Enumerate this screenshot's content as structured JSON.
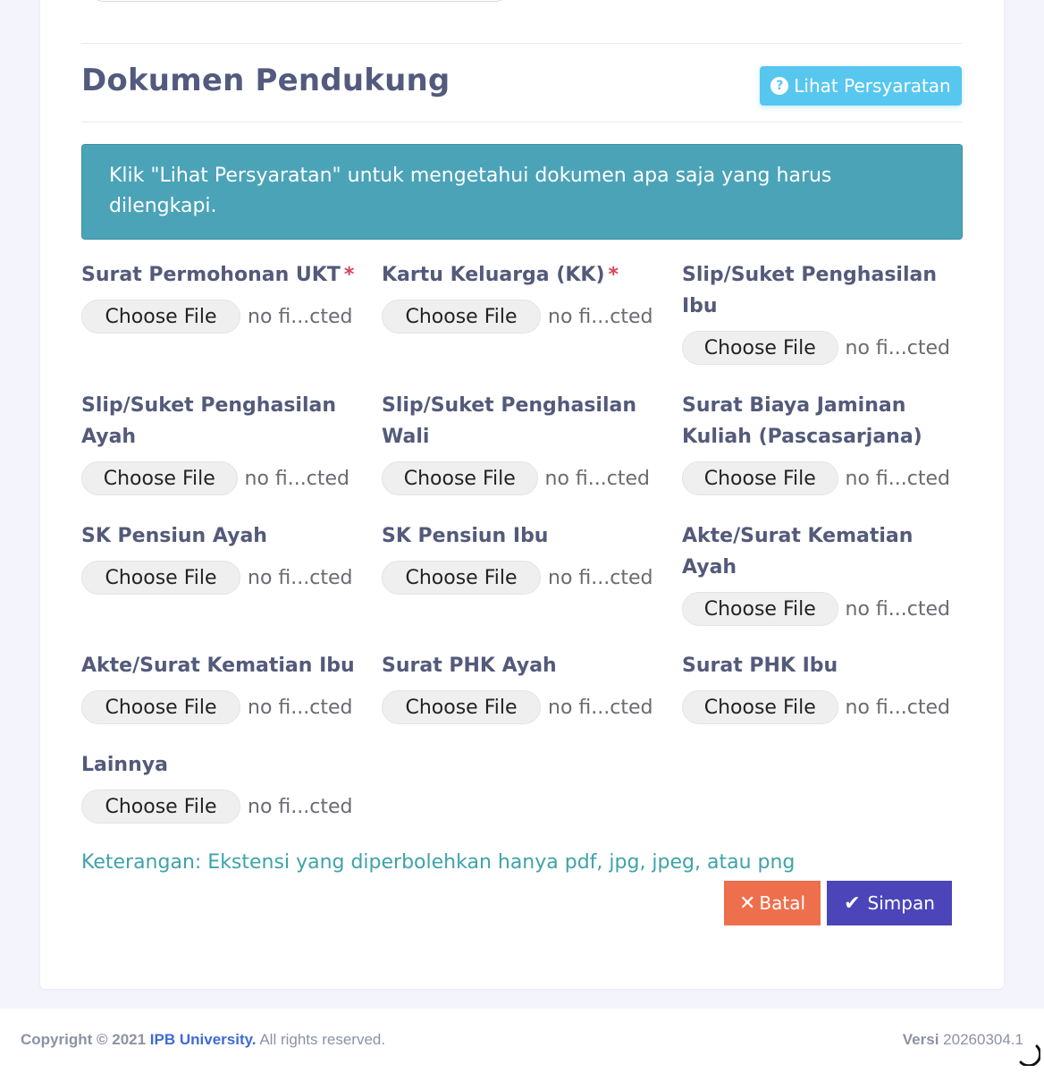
{
  "section": {
    "title": "Dokumen Pendukung",
    "requirements_button": "Lihat Persyaratan",
    "requirements_icon": "question-circle-icon"
  },
  "alert": {
    "text": "Klik \"Lihat Persyaratan\" untuk mengetahui dokumen apa saja yang harus dilengkapi."
  },
  "upload_fields": [
    {
      "label": "Surat Permohonan UKT",
      "required": "*",
      "button": "Choose File",
      "status": "no fi...cted"
    },
    {
      "label": "Kartu Keluarga (KK)",
      "required": "*",
      "button": "Choose File",
      "status": "no fi...cted"
    },
    {
      "label": "Slip/Suket Penghasilan Ibu",
      "required": "",
      "button": "Choose File",
      "status": "no fi...cted"
    },
    {
      "label": "Slip/Suket Penghasilan Ayah",
      "required": "",
      "button": "Choose File",
      "status": "no fi...cted"
    },
    {
      "label": "Slip/Suket Penghasilan Wali",
      "required": "",
      "button": "Choose File",
      "status": "no fi...cted"
    },
    {
      "label": "Surat Biaya Jaminan Kuliah (Pascasarjana)",
      "required": "",
      "button": "Choose File",
      "status": "no fi...cted"
    },
    {
      "label": "SK Pensiun Ayah",
      "required": "",
      "button": "Choose File",
      "status": "no fi...cted"
    },
    {
      "label": "SK Pensiun Ibu",
      "required": "",
      "button": "Choose File",
      "status": "no fi...cted"
    },
    {
      "label": "Akte/Surat Kematian Ayah",
      "required": "",
      "button": "Choose File",
      "status": "no fi...cted"
    },
    {
      "label": "Akte/Surat Kematian Ibu",
      "required": "",
      "button": "Choose File",
      "status": "no fi...cted"
    },
    {
      "label": "Surat PHK Ayah",
      "required": "",
      "button": "Choose File",
      "status": "no fi...cted"
    },
    {
      "label": "Surat PHK Ibu",
      "required": "",
      "button": "Choose File",
      "status": "no fi...cted"
    },
    {
      "label": "Lainnya",
      "required": "",
      "button": "Choose File",
      "status": "no fi...cted"
    }
  ],
  "note": "Keterangan: Ekstensi yang diperbolehkan hanya pdf, jpg, jpeg, atau png",
  "actions": {
    "cancel": "Batal",
    "save": "Simpan"
  },
  "footer": {
    "copyright_prefix": "Copyright © 2021",
    "brand": "IPB University.",
    "rights": "All rights reserved.",
    "version_label": "Versi",
    "version_value": "20260304.1"
  },
  "colors": {
    "accent_info": "#57c7ef",
    "alert_bg": "#4ba3b8",
    "cancel": "#ee6f4c",
    "save": "#4b45b9",
    "required": "#d9435a",
    "note": "#3ea3a8",
    "brand": "#3f6ad8"
  }
}
